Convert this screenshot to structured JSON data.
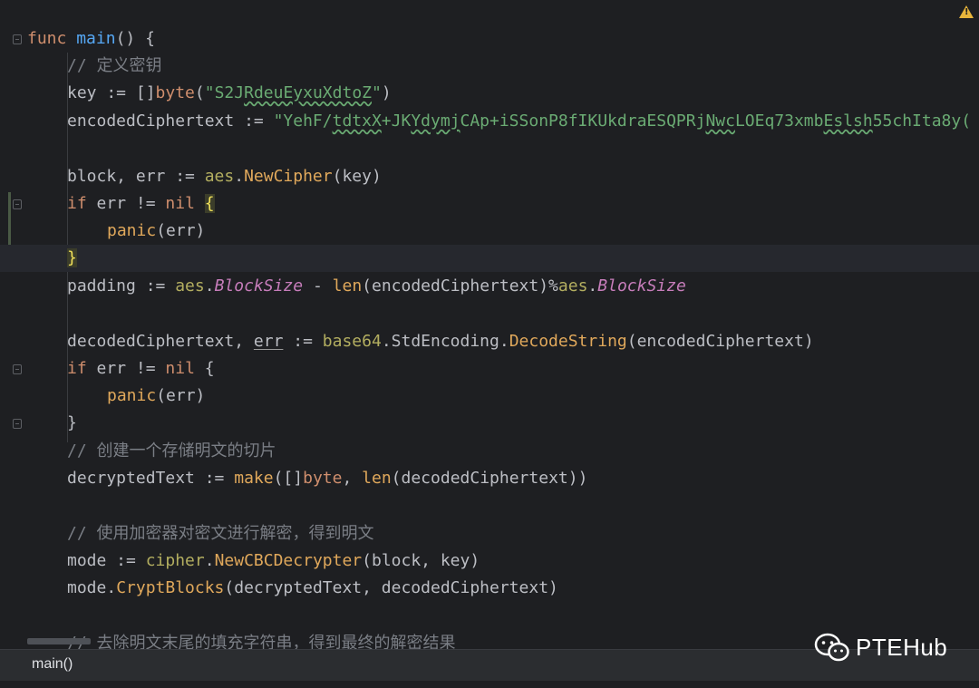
{
  "editor": {
    "breadcrumb": "main()",
    "warning_badge": "!",
    "lines": {
      "l1": {
        "kw": "func",
        "name": "main",
        "rest": "() {"
      },
      "l2": "// 定义密钥",
      "l3": {
        "a": "key := []",
        "b": "byte",
        "c": "(",
        "s1": "\"S2J",
        "s2": "RdeuEyxuXdtoZ",
        "s3": "\"",
        "d": ")"
      },
      "l4": {
        "a": "encodedCiphertext := ",
        "s1": "\"YehF/",
        "s2": "tdtxX",
        "s3": "+JK",
        "s4": "Ydymj",
        "s5": "CAp+iSSonP8fIKUkdraESQPRj",
        "s6": "Nwc",
        "s7": "LOEq73xmb",
        "s8": "Eslsh",
        "s9": "55chIta8y("
      },
      "l6": {
        "a": "block, err := ",
        "pkg": "aes",
        "dot": ".",
        "m": "NewCipher",
        "b": "(key)"
      },
      "l7": {
        "kw": "if",
        "a": " err != ",
        "kw2": "nil",
        "sp": " ",
        "brace": "{"
      },
      "l8": {
        "fn": "panic",
        "a": "(err)"
      },
      "l9": {
        "brace": "}"
      },
      "l10": {
        "a": "padding := ",
        "pkg": "aes",
        "dot": ".",
        "c": "BlockSize",
        "b": " - ",
        "fn": "len",
        "d": "(encodedCiphertext)%",
        "pkg2": "aes",
        "dot2": ".",
        "c2": "BlockSize"
      },
      "l12": {
        "a": "decodedCiphertext, ",
        "err": "err",
        "b": " := ",
        "pkg": "base64",
        "dot": ".StdEncoding.",
        "m": "DecodeString",
        "c": "(encodedCiphertext)"
      },
      "l13": {
        "kw": "if",
        "a": " err != ",
        "kw2": "nil",
        "b": " {"
      },
      "l14": {
        "fn": "panic",
        "a": "(err)"
      },
      "l15": "}",
      "l16": "// 创建一个存储明文的切片",
      "l17": {
        "a": "decryptedText := ",
        "fn": "make",
        "b": "([]",
        "kw": "byte",
        "c": ", ",
        "fn2": "len",
        "d": "(decodedCiphertext))"
      },
      "l19": "// 使用加密器对密文进行解密，得到明文",
      "l20": {
        "a": "mode := ",
        "pkg": "cipher",
        "dot": ".",
        "m": "NewCBCDecrypter",
        "b": "(block, key)"
      },
      "l21": {
        "a": "mode.",
        "m": "CryptBlocks",
        "b": "(decryptedText, decodedCiphertext)"
      },
      "l23": "// 去除明文末尾的填充字符串，得到最终的解密结果"
    }
  },
  "watermark": {
    "text": "PTEHub",
    "icon": "wechat-icon"
  },
  "colors": {
    "background": "#1e1f22",
    "keyword": "#cf8e6d",
    "string": "#6aab73",
    "comment": "#7a7e85",
    "method": "#e0a85b",
    "constant": "#c77dbb"
  }
}
